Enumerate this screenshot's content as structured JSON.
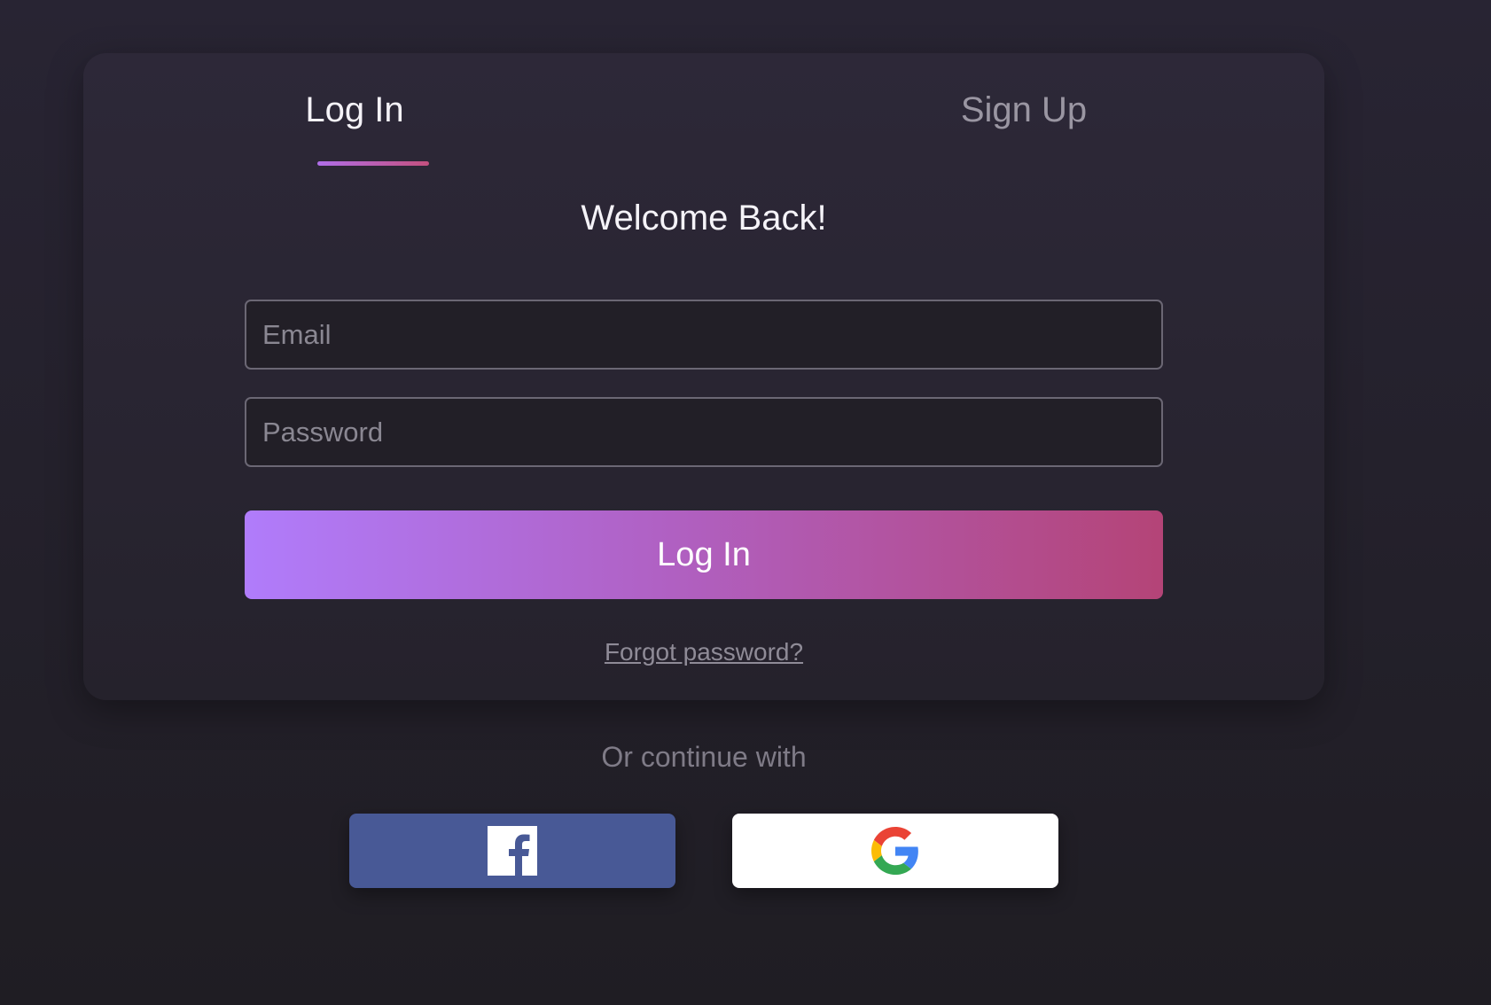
{
  "tabs": {
    "login": "Log In",
    "signup": "Sign Up",
    "active": "login"
  },
  "form": {
    "title": "Welcome Back!",
    "email": {
      "placeholder": "Email",
      "value": ""
    },
    "password": {
      "placeholder": "Password",
      "value": ""
    },
    "submit_label": "Log In",
    "forgot_label": "Forgot password?"
  },
  "social": {
    "divider_text": "Or continue with",
    "facebook_icon": "facebook-icon",
    "google_icon": "google-icon"
  },
  "colors": {
    "background": "#23202a",
    "card": "#2a2633",
    "accent_start": "#b07cfb",
    "accent_end": "#b44477",
    "facebook": "#485996",
    "google_button": "#ffffff"
  }
}
